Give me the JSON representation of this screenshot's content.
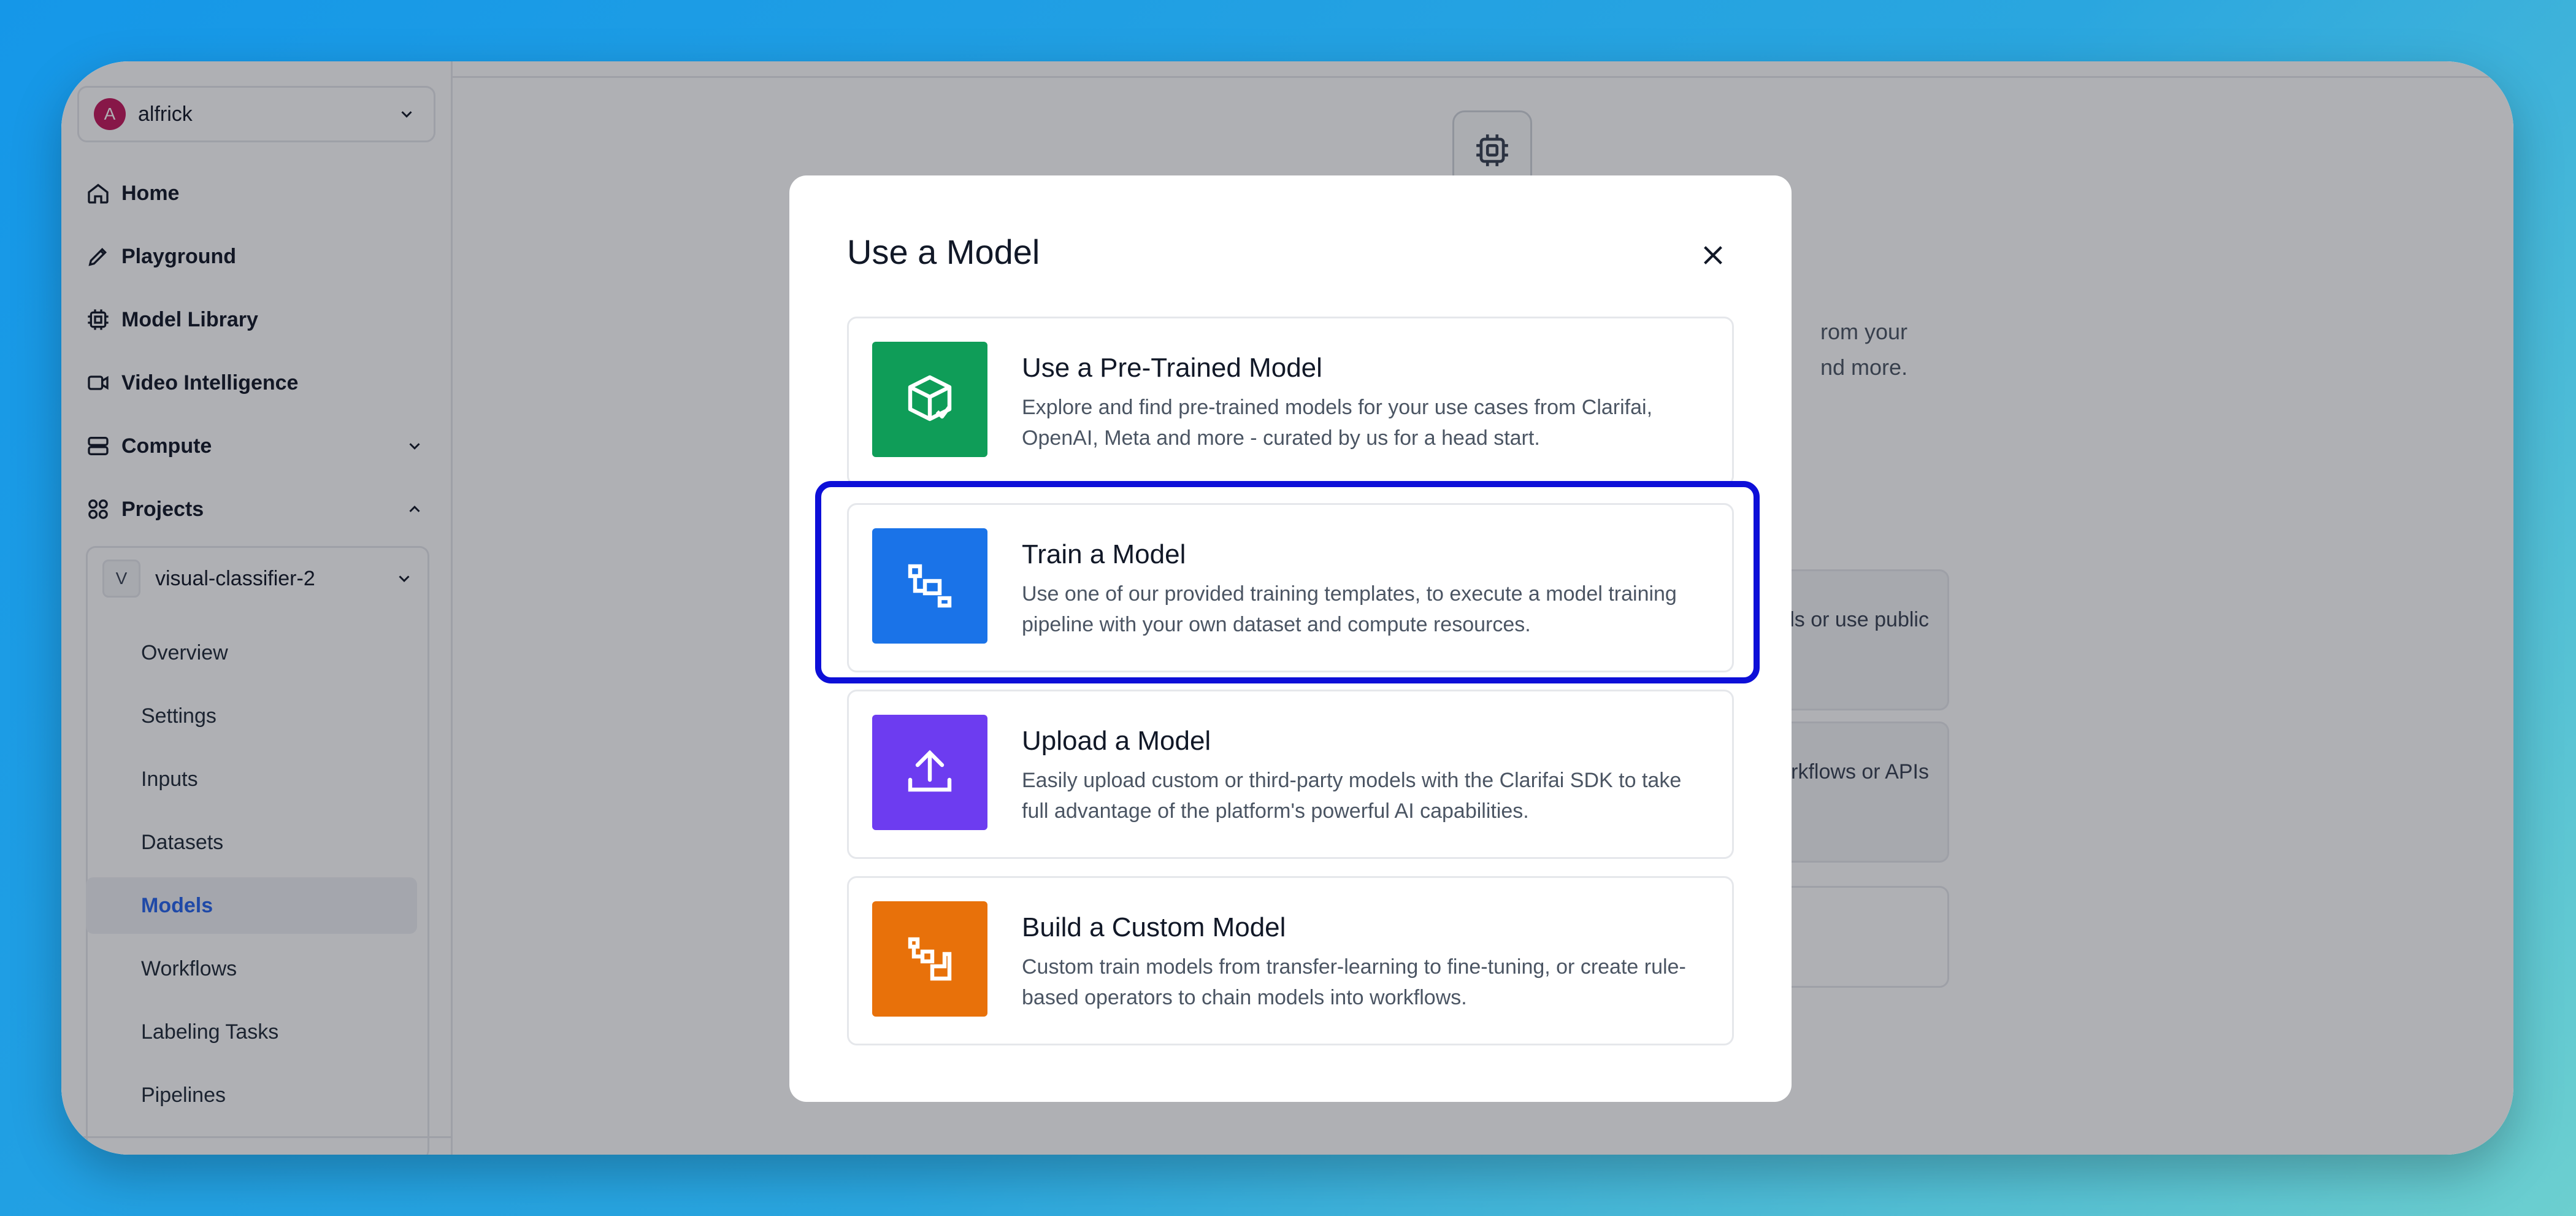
{
  "account": {
    "initial": "A",
    "name": "alfrick"
  },
  "nav": {
    "items": [
      {
        "label": "Home",
        "icon": "home-icon"
      },
      {
        "label": "Playground",
        "icon": "pencil-icon"
      },
      {
        "label": "Model Library",
        "icon": "chip-icon"
      },
      {
        "label": "Video Intelligence",
        "icon": "video-icon"
      },
      {
        "label": "Compute",
        "icon": "server-icon"
      },
      {
        "label": "Projects",
        "icon": "grid-icon"
      }
    ]
  },
  "project": {
    "badge": "V",
    "name": "visual-classifier-2",
    "items": [
      {
        "label": "Overview"
      },
      {
        "label": "Settings"
      },
      {
        "label": "Inputs"
      },
      {
        "label": "Datasets"
      },
      {
        "label": "Models",
        "active": true
      },
      {
        "label": "Workflows"
      },
      {
        "label": "Labeling Tasks"
      },
      {
        "label": "Pipelines"
      }
    ]
  },
  "background": {
    "line1": "rom your",
    "line2": "nd more.",
    "card1": "dels or use public",
    "card2": "o workflows or APIs"
  },
  "modal": {
    "title": "Use a Model",
    "options": [
      {
        "title": "Use a Pre-Trained Model",
        "description": "Explore and find pre-trained models for your use cases from Clarifai, OpenAI, Meta and more - curated by us for a head start.",
        "icon": "cube-check-icon",
        "color": "#0f9d58"
      },
      {
        "title": "Train a Model",
        "description": "Use one of our provided training templates, to execute a model training pipeline with your own dataset and compute resources.",
        "icon": "train-squares-icon",
        "color": "#1a73e8"
      },
      {
        "title": "Upload a Model",
        "description": "Easily upload custom or third-party models with the Clarifai SDK to take full advantage of the platform's powerful AI capabilities.",
        "icon": "upload-icon",
        "color": "#6d3cf0"
      },
      {
        "title": "Build a Custom Model",
        "description": "Custom train models from transfer-learning to fine-tuning, or create rule-based operators to chain models into workflows.",
        "icon": "custom-blocks-icon",
        "color": "#e8710a"
      }
    ]
  },
  "colors": {
    "highlight": "#0d0fd8",
    "active_nav": "#2563eb"
  }
}
